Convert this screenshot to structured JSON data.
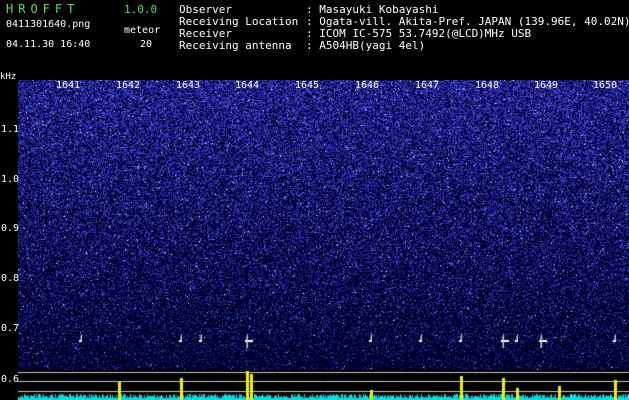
{
  "app": {
    "title": "HROFFT",
    "version": "1.0.0",
    "file_name": "0411301640.png",
    "timestamp": "04.11.30 16:40"
  },
  "meteor": {
    "label": "meteor",
    "count": "20"
  },
  "info": [
    {
      "label": "Observer",
      "value": ": Masayuki Kobayashi"
    },
    {
      "label": "Receiving Location",
      "value": ": Ogata-vill. Akita-Pref. JAPAN (139.96E, 40.02N)"
    },
    {
      "label": "Receiver",
      "value": ": ICOM IC-575 53.7492(@LCD)MHz USB"
    },
    {
      "label": "Receiving antenna",
      "value": ": A504HB(yagi 4el)"
    }
  ],
  "axes": {
    "freq_unit": "kHz",
    "time_ticks": [
      "1641",
      "1642",
      "1643",
      "1644",
      "1645",
      "1646",
      "1647",
      "1648",
      "1649",
      "1650"
    ],
    "freq_ticks": [
      "1.1",
      "1.0",
      "0.9",
      "0.8",
      "0.7",
      "0.6"
    ]
  },
  "colors": {
    "title_green": "#4fe04f",
    "spectrogram_bg": "#000030",
    "noise_blue": "#3030c8",
    "histogram_cyan": "#00e0e0",
    "histogram_yellow": "#f0f000",
    "guide_line": "#c8c8c8"
  }
}
